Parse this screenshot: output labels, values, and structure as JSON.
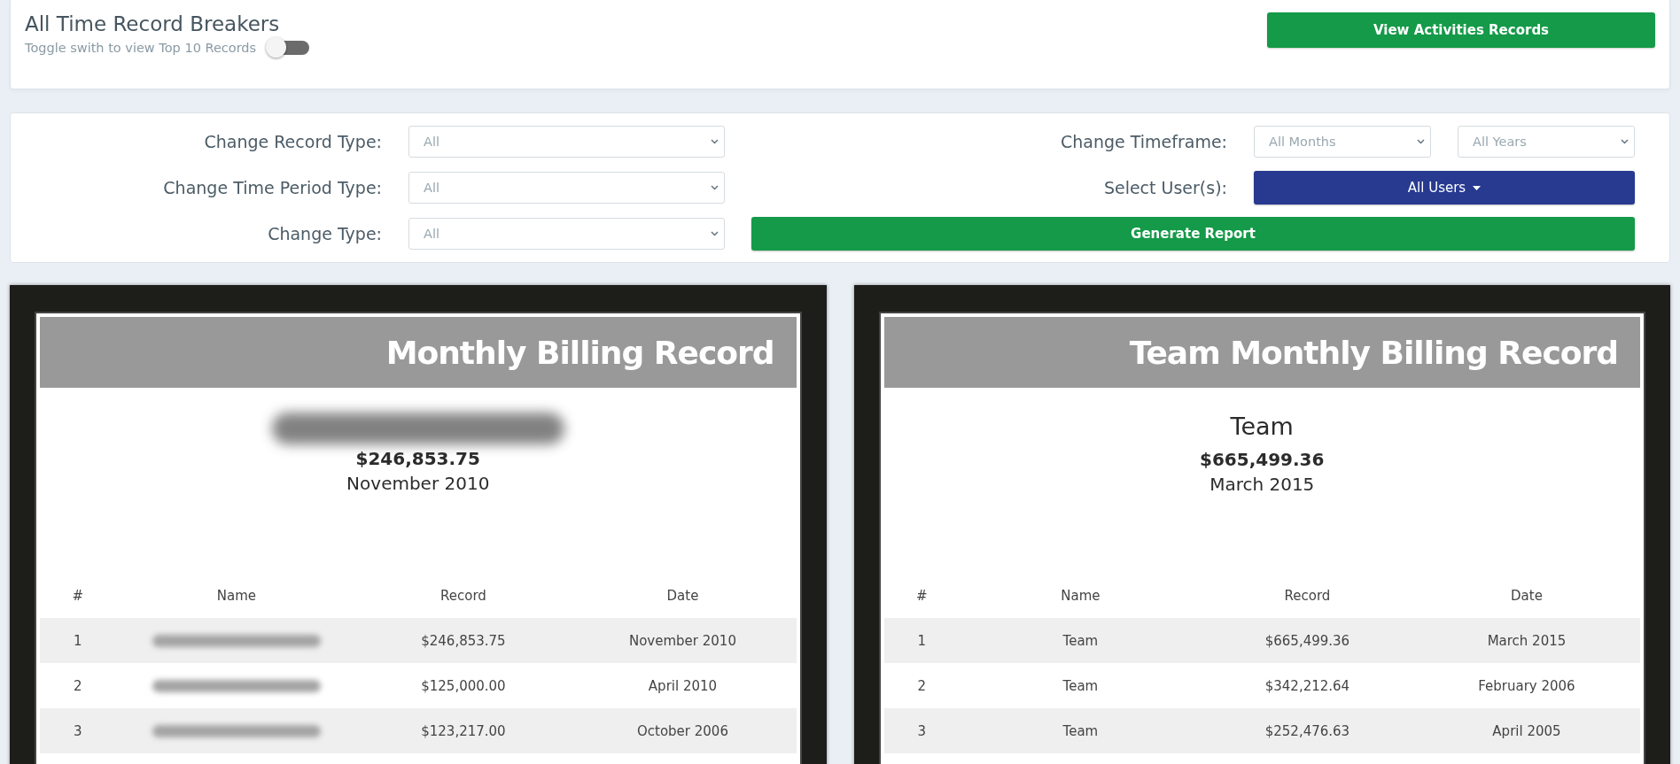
{
  "header": {
    "title": "All Time Record Breakers",
    "toggle": {
      "label": "Toggle swith to view Top 10 Records",
      "on": false
    },
    "button": "View Activities Records"
  },
  "filters": {
    "record_type": {
      "label": "Change Record Type:",
      "value": "All"
    },
    "time_period_type": {
      "label": "Change Time Period Type:",
      "value": "All"
    },
    "change_type": {
      "label": "Change Type:",
      "value": "All"
    },
    "timeframe": {
      "label": "Change Timeframe:",
      "month": "All Months",
      "year": "All Years"
    },
    "users": {
      "label": "Select User(s):",
      "button": "All Users"
    },
    "generate_button": "Generate Report"
  },
  "records": [
    {
      "title": "Monthly Billing Record",
      "holder": {
        "kind": "redacted"
      },
      "amount": "$246,853.75",
      "date": "November 2010",
      "columns": [
        "#",
        "Name",
        "Record",
        "Date"
      ],
      "rows": [
        {
          "rank": "1",
          "name": {
            "kind": "redacted"
          },
          "record": "$246,853.75",
          "date": "November 2010"
        },
        {
          "rank": "2",
          "name": {
            "kind": "redacted"
          },
          "record": "$125,000.00",
          "date": "April 2010"
        },
        {
          "rank": "3",
          "name": {
            "kind": "redacted"
          },
          "record": "$123,217.00",
          "date": "October 2006"
        }
      ]
    },
    {
      "title": "Team Monthly Billing Record",
      "holder": {
        "kind": "text",
        "text": "Team"
      },
      "amount": "$665,499.36",
      "date": "March 2015",
      "columns": [
        "#",
        "Name",
        "Record",
        "Date"
      ],
      "rows": [
        {
          "rank": "1",
          "name": {
            "kind": "text",
            "text": "Team"
          },
          "record": "$665,499.36",
          "date": "March 2015"
        },
        {
          "rank": "2",
          "name": {
            "kind": "text",
            "text": "Team"
          },
          "record": "$342,212.64",
          "date": "February 2006"
        },
        {
          "rank": "3",
          "name": {
            "kind": "text",
            "text": "Team"
          },
          "record": "$252,476.63",
          "date": "April 2005"
        }
      ]
    }
  ]
}
